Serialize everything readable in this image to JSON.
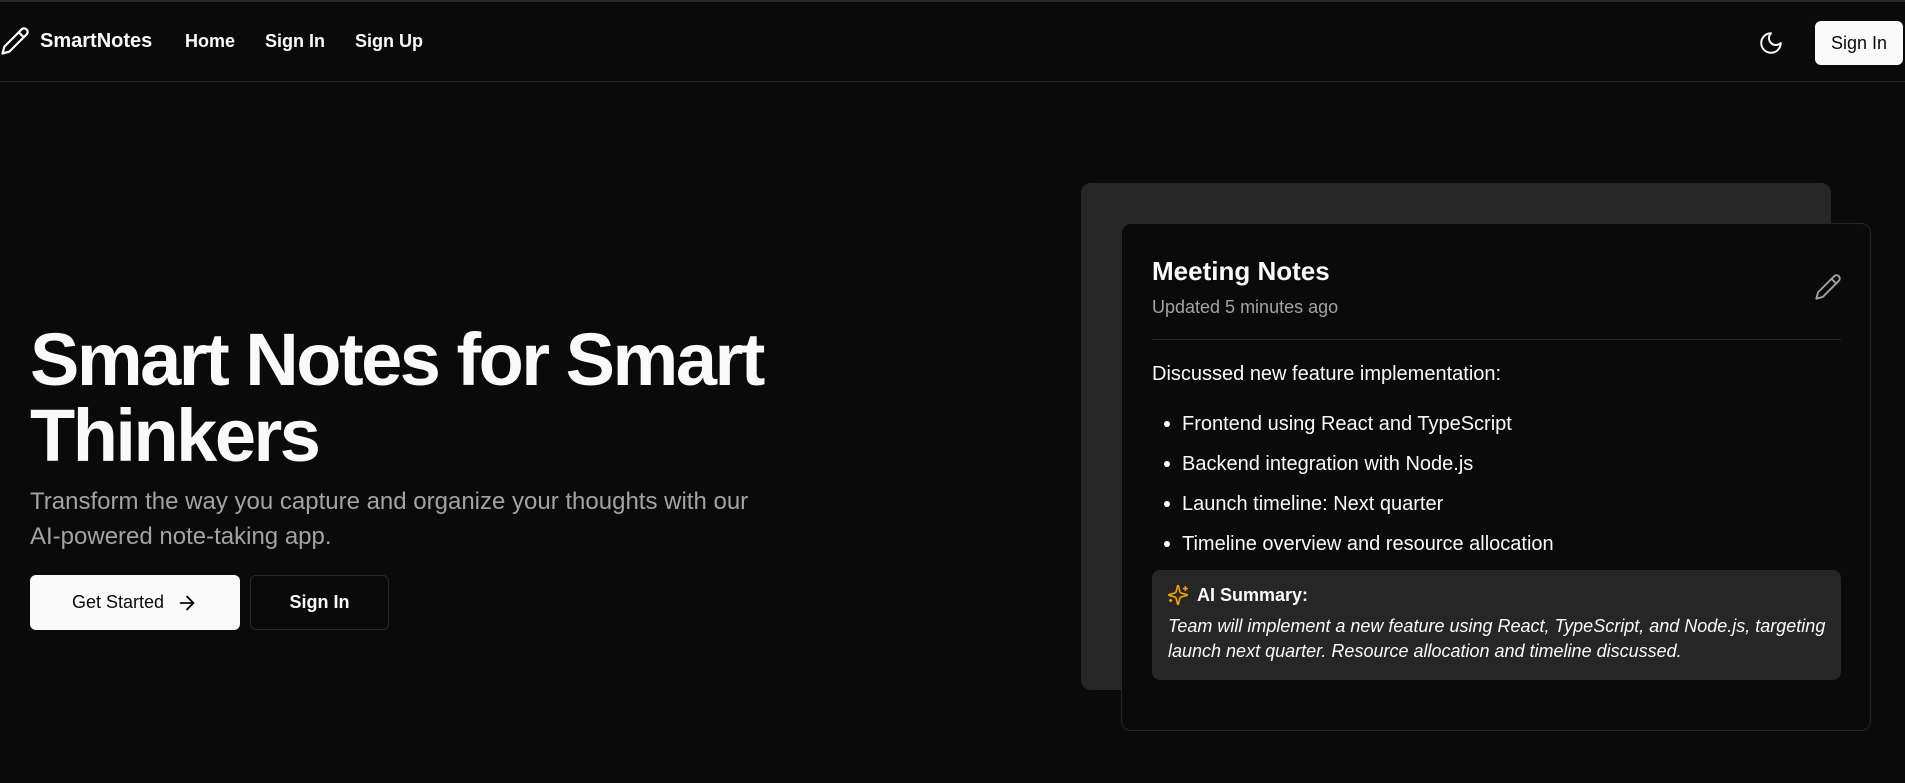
{
  "brand": {
    "name": "SmartNotes",
    "icon": "pencil-icon"
  },
  "nav": {
    "links": [
      "Home",
      "Sign In",
      "Sign Up"
    ],
    "theme_icon": "moon-icon",
    "signin_label": "Sign In"
  },
  "hero": {
    "title": "Smart Notes for Smart Thinkers",
    "subtitle": "Transform the way you capture and organize your thoughts with our AI-powered note-taking app.",
    "primary_button": "Get Started",
    "primary_icon": "arrow-right-icon",
    "secondary_button": "Sign In"
  },
  "note_card": {
    "title": "Meeting Notes",
    "updated": "Updated 5 minutes ago",
    "edit_icon": "pencil-icon",
    "intro": "Discussed new feature implementation:",
    "items": [
      "Frontend using React and TypeScript",
      "Backend integration with Node.js",
      "Launch timeline: Next quarter",
      "Timeline overview and resource allocation"
    ],
    "summary": {
      "icon": "sparkles-icon",
      "label": "AI Summary:",
      "text": "Team will implement a new feature using React, TypeScript, and Node.js, targeting launch next quarter. Resource allocation and timeline discussed."
    }
  },
  "colors": {
    "background": "#0a0a0a",
    "foreground": "#fafafa",
    "muted": "#a3a3a3",
    "card_muted": "#262626",
    "accent_sparkle": "#f59e0b"
  }
}
